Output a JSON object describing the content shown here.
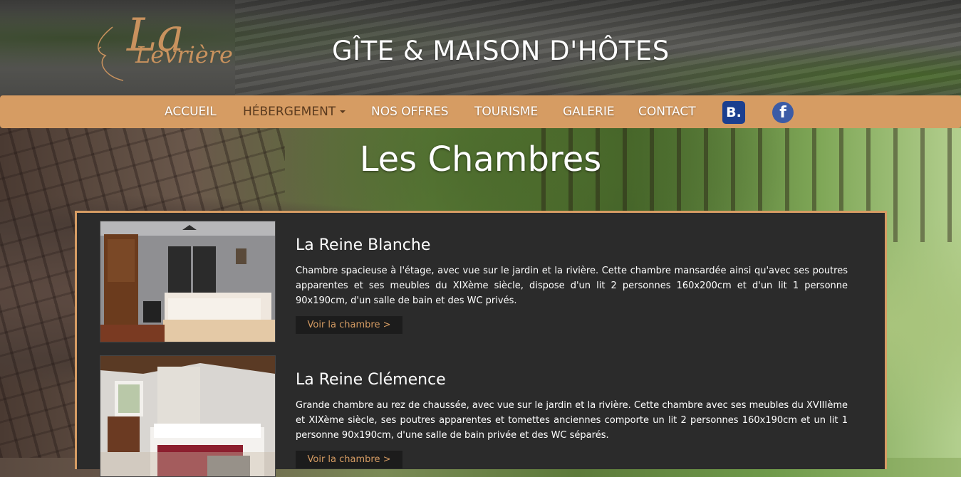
{
  "header": {
    "logo_big": "La",
    "logo_small": "Levrière",
    "site_title": "GÎTE & MAISON D'HÔTES"
  },
  "nav": {
    "items": [
      {
        "label": "ACCUEIL"
      },
      {
        "label": "HÉBERGEMENT"
      },
      {
        "label": "NOS OFFRES"
      },
      {
        "label": "TOURISME"
      },
      {
        "label": "GALERIE"
      },
      {
        "label": "CONTACT"
      }
    ],
    "booking_icon": "booking-icon",
    "booking_label": "B.",
    "facebook_icon": "facebook-icon",
    "facebook_label": "f",
    "accent_color": "#d69c63",
    "active_color": "#5a3a1e"
  },
  "page": {
    "title": "Les Chambres"
  },
  "rooms": [
    {
      "title": "La Reine Blanche",
      "description": "Chambre spacieuse à l'étage, avec vue sur le jardin et la rivière. Cette chambre mansardée  ainsi qu'avec ses poutres apparentes et ses meubles du XIXème siècle, dispose d'un lit  2 personnes 160x200cm et d'un lit 1 personne 90x190cm, d'un salle de bain et des WC privés.",
      "button": "Voir la chambre  >"
    },
    {
      "title": "La Reine Clémence",
      "description": "Grande chambre au rez de chaussée, avec vue sur le jardin et la rivière. Cette chambre avec ses meubles du XVIIIème et XIXème siècle, ses poutres apparentes et tomettes anciennes comporte un lit 2 personnes 160x190cm et un lit 1 personne 90x190cm, d'une salle de bain privée et des WC séparés.",
      "button": "Voir la chambre  >"
    }
  ]
}
